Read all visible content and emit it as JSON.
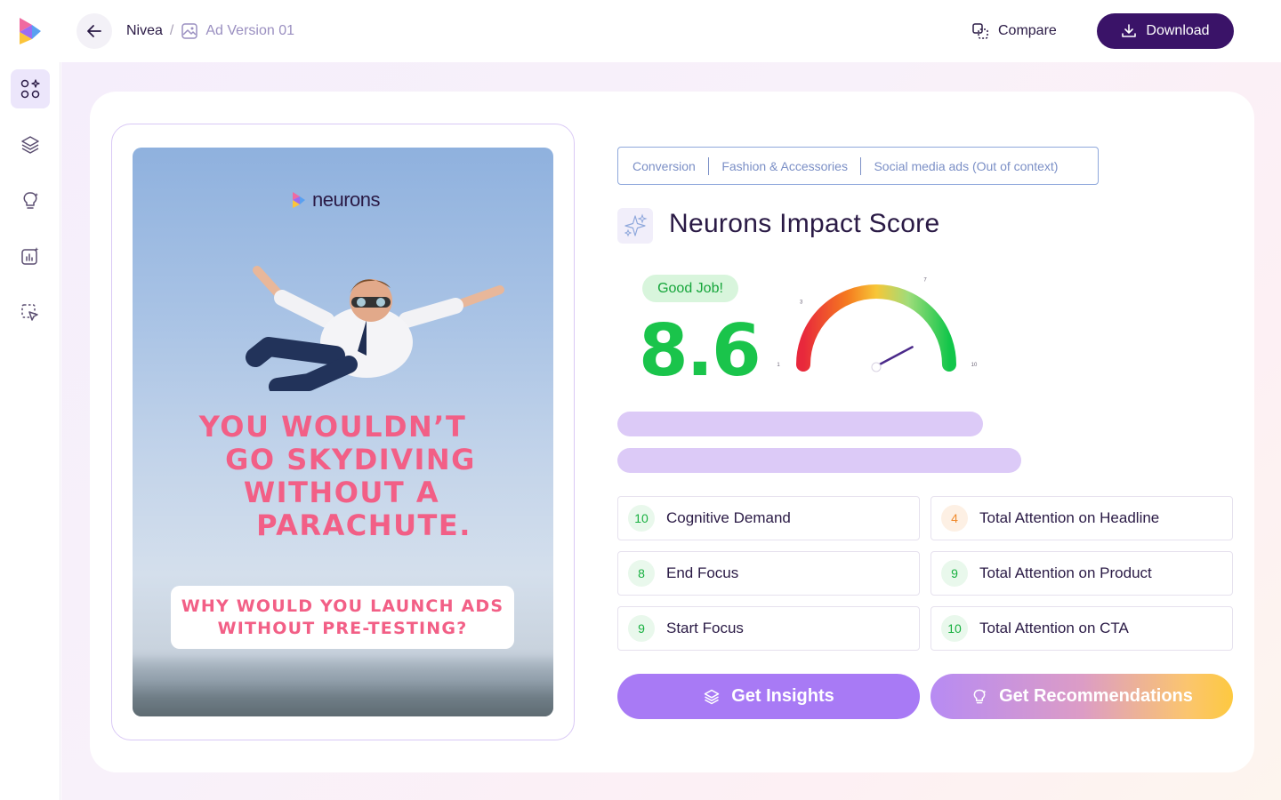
{
  "header": {
    "breadcrumb_root": "Nivea",
    "breadcrumb_sep": "/",
    "breadcrumb_current": "Ad Version 01",
    "compare_label": "Compare",
    "download_label": "Download"
  },
  "sidebar": {
    "items": [
      {
        "icon": "apps-sparkle-icon",
        "active": true
      },
      {
        "icon": "layers-icon",
        "active": false
      },
      {
        "icon": "lightbulb-icon",
        "active": false
      },
      {
        "icon": "chart-sparkle-icon",
        "active": false
      },
      {
        "icon": "cursor-select-icon",
        "active": false
      }
    ]
  },
  "ad": {
    "brand": "neurons",
    "headline_lines": [
      "YOU WOULDN’T",
      "GO SKYDIVING",
      "WITHOUT A",
      "PARACHUTE."
    ],
    "subline_lines": [
      "WHY WOULD YOU LAUNCH ADS",
      "WITHOUT PRE-TESTING?"
    ]
  },
  "tags": [
    "Conversion",
    "Fashion & Accessories",
    "Social media ads (Out of context)"
  ],
  "score": {
    "title": "Neurons Impact Score",
    "badge": "Good Job!",
    "value": "8.6",
    "value_num": 8.6,
    "gauge_min": 1,
    "gauge_max": 10,
    "gauge_ticks": [
      "1",
      "3",
      "5",
      "7",
      "10"
    ]
  },
  "metrics": [
    {
      "value": "10",
      "label": "Cognitive Demand",
      "tone": "green"
    },
    {
      "value": "4",
      "label": "Total Attention on Headline",
      "tone": "orange"
    },
    {
      "value": "8",
      "label": "End Focus",
      "tone": "green"
    },
    {
      "value": "9",
      "label": "Total Attention on Product",
      "tone": "green"
    },
    {
      "value": "9",
      "label": "Start Focus",
      "tone": "green"
    },
    {
      "value": "10",
      "label": "Total Attention on CTA",
      "tone": "green"
    }
  ],
  "actions": {
    "insights_label": "Get Insights",
    "recommendations_label": "Get Recommendations"
  },
  "colors": {
    "accent_dark": "#3a1368",
    "score_green": "#1ac44b",
    "headline_pink": "#f25f86",
    "purple_button": "#a87af5"
  }
}
